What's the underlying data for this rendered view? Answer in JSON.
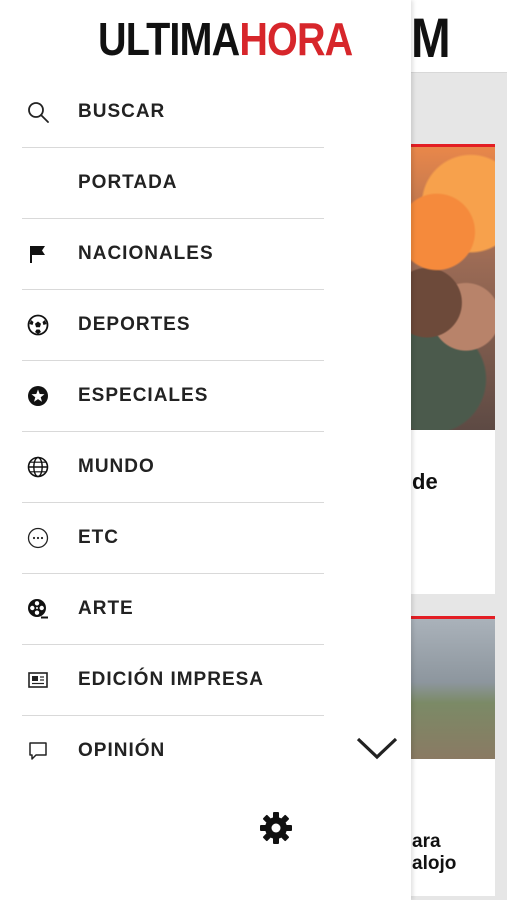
{
  "app": {
    "logo": {
      "part1": "ULTIMA",
      "part2": "HORA"
    },
    "background_logo_fragment": "M"
  },
  "menu": {
    "items": [
      {
        "label": "BUSCAR",
        "icon": "search-icon"
      },
      {
        "label": "PORTADA",
        "icon": ""
      },
      {
        "label": "NACIONALES",
        "icon": "flag-icon"
      },
      {
        "label": "DEPORTES",
        "icon": "soccer-ball-icon"
      },
      {
        "label": "ESPECIALES",
        "icon": "star-circle-icon"
      },
      {
        "label": "MUNDO",
        "icon": "globe-icon"
      },
      {
        "label": "ETC",
        "icon": "more-circle-icon"
      },
      {
        "label": "ARTE",
        "icon": "film-reel-icon"
      },
      {
        "label": "EDICIÓN IMPRESA",
        "icon": "newspaper-icon"
      },
      {
        "label": "OPINIÓN",
        "icon": "comment-icon"
      }
    ],
    "settings_icon": "gear-icon",
    "expand_icon": "chevron-down-icon"
  },
  "background": {
    "card1_text": "de",
    "card2_text_line1": "ara",
    "card2_text_line2": "alojo"
  },
  "colors": {
    "brand_red": "#d7262b",
    "text_dark": "#222222",
    "divider": "#d9d9d9"
  }
}
